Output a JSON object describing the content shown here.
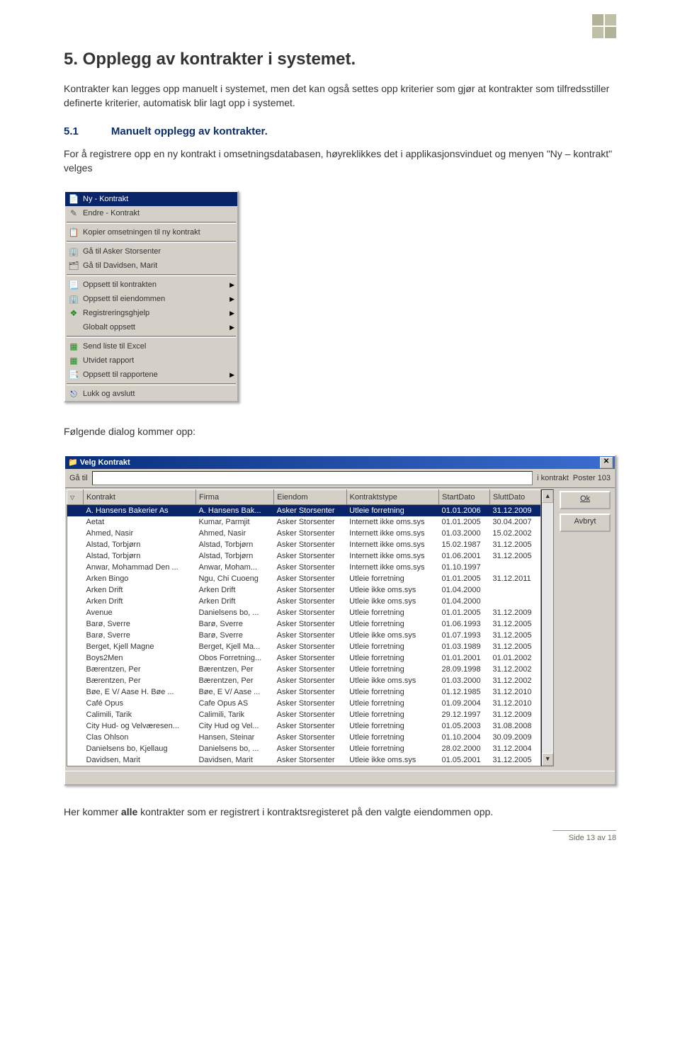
{
  "doc": {
    "section_title": "5. Opplegg av kontrakter i systemet.",
    "p1": "Kontrakter kan legges opp manuelt i systemet, men det kan også settes opp kriterier som gjør at kontrakter som tilfredsstiller definerte kriterier, automatisk blir lagt opp i systemet.",
    "sub_num": "5.1",
    "sub_title": "Manuelt opplegg av kontrakter.",
    "p2": "For å registrere opp en ny kontrakt i omsetningsdatabasen, høyreklikkes det i applikasjonsvinduet og menyen \"Ny – kontrakt\" velges",
    "p3": "Følgende dialog kommer opp:",
    "p4a": "Her kommer ",
    "p4b": "alle",
    "p4c": " kontrakter som er registrert i kontraktsregisteret på den valgte eiendommen opp.",
    "page_number": "Side 13 av 18"
  },
  "menu": {
    "items": [
      {
        "label": "Ny - Kontrakt",
        "selected": true,
        "sep": false,
        "sub": false,
        "icon": "doc"
      },
      {
        "label": "Endre - Kontrakt",
        "sep": false,
        "sub": false,
        "icon": "edit"
      },
      {
        "label": "",
        "sep": true
      },
      {
        "label": "Kopier omsetningen til ny kontrakt",
        "sep": false,
        "sub": false,
        "icon": "copy"
      },
      {
        "label": "",
        "sep": true
      },
      {
        "label": "Gå til Asker Storsenter",
        "sep": false,
        "sub": false,
        "icon": "bld"
      },
      {
        "label": "Gå til Davidsen, Marit",
        "sep": false,
        "sub": false,
        "icon": "card"
      },
      {
        "label": "",
        "sep": true
      },
      {
        "label": "Oppsett til kontrakten",
        "sep": false,
        "sub": true,
        "icon": "page"
      },
      {
        "label": "Oppsett til eiendommen",
        "sep": false,
        "sub": true,
        "icon": "bld"
      },
      {
        "label": "Registreringsghjelp",
        "sep": false,
        "sub": true,
        "icon": "help"
      },
      {
        "label": "Globalt oppsett",
        "sep": false,
        "sub": true,
        "icon": ""
      },
      {
        "label": "",
        "sep": true
      },
      {
        "label": "Send liste til Excel",
        "sep": false,
        "sub": false,
        "icon": "xlsx"
      },
      {
        "label": "Utvidet rapport",
        "sep": false,
        "sub": false,
        "icon": "xlsx"
      },
      {
        "label": "Oppsett til rapportene",
        "sep": false,
        "sub": true,
        "icon": "rep"
      },
      {
        "label": "",
        "sep": true
      },
      {
        "label": "Lukk og avslutt",
        "sep": false,
        "sub": false,
        "icon": "exit"
      }
    ]
  },
  "dialog": {
    "title": "Velg Kontrakt",
    "goto_label": "Gå til",
    "in_contract": "i kontrakt",
    "posts": "Poster 103",
    "ok": "Ok",
    "cancel": "Avbryt",
    "columns": [
      "",
      "Kontrakt",
      "Firma",
      "Eiendom",
      "Kontraktstype",
      "StartDato",
      "SluttDato"
    ],
    "rows": [
      [
        "A. Hansens Bakerier As",
        "A. Hansens Bak...",
        "Asker Storsenter",
        "Utleie forretning",
        "01.01.2006",
        "31.12.2009",
        true
      ],
      [
        "Aetat",
        "Kumar, Parmjit",
        "Asker Storsenter",
        "Internett ikke oms.sys",
        "01.01.2005",
        "30.04.2007",
        false
      ],
      [
        "Ahmed, Nasir",
        "Ahmed, Nasir",
        "Asker Storsenter",
        "Internett ikke oms.sys",
        "01.03.2000",
        "15.02.2002",
        false
      ],
      [
        "Alstad, Torbjørn",
        "Alstad, Torbjørn",
        "Asker Storsenter",
        "Internett ikke oms.sys",
        "15.02.1987",
        "31.12.2005",
        false
      ],
      [
        "Alstad, Torbjørn",
        "Alstad, Torbjørn",
        "Asker Storsenter",
        "Internett ikke oms.sys",
        "01.06.2001",
        "31.12.2005",
        false
      ],
      [
        "Anwar, Mohammad Den ...",
        "Anwar, Moham...",
        "Asker Storsenter",
        "Internett ikke oms.sys",
        "01.10.1997",
        "",
        false
      ],
      [
        "Arken Bingo",
        "Ngu, Chi Cuoeng",
        "Asker Storsenter",
        "Utleie forretning",
        "01.01.2005",
        "31.12.2011",
        false
      ],
      [
        "Arken Drift",
        "Arken Drift",
        "Asker Storsenter",
        "Utleie ikke oms.sys",
        "01.04.2000",
        "",
        false
      ],
      [
        "Arken Drift",
        "Arken Drift",
        "Asker Storsenter",
        "Utleie ikke oms.sys",
        "01.04.2000",
        "",
        false
      ],
      [
        "Avenue",
        "Danielsens bo, ...",
        "Asker Storsenter",
        "Utleie forretning",
        "01.01.2005",
        "31.12.2009",
        false
      ],
      [
        "Barø, Sverre",
        "Barø, Sverre",
        "Asker Storsenter",
        "Utleie forretning",
        "01.06.1993",
        "31.12.2005",
        false
      ],
      [
        "Barø, Sverre",
        "Barø, Sverre",
        "Asker Storsenter",
        "Utleie ikke oms.sys",
        "01.07.1993",
        "31.12.2005",
        false
      ],
      [
        "Berget, Kjell Magne",
        "Berget, Kjell Ma...",
        "Asker Storsenter",
        "Utleie forretning",
        "01.03.1989",
        "31.12.2005",
        false
      ],
      [
        "Boys2Men",
        "Obos Forretning...",
        "Asker Storsenter",
        "Utleie forretning",
        "01.01.2001",
        "01.01.2002",
        false
      ],
      [
        "Bærentzen, Per",
        "Bærentzen, Per",
        "Asker Storsenter",
        "Utleie forretning",
        "28.09.1998",
        "31.12.2002",
        false
      ],
      [
        "Bærentzen, Per",
        "Bærentzen, Per",
        "Asker Storsenter",
        "Utleie ikke oms.sys",
        "01.03.2000",
        "31.12.2002",
        false
      ],
      [
        "Bøe, E V/ Aase H. Bøe ...",
        "Bøe, E V/ Aase ...",
        "Asker Storsenter",
        "Utleie forretning",
        "01.12.1985",
        "31.12.2010",
        false
      ],
      [
        "Café Opus",
        "Cafe Opus AS",
        "Asker Storsenter",
        "Utleie forretning",
        "01.09.2004",
        "31.12.2010",
        false
      ],
      [
        "Calimili, Tarik",
        "Calimili, Tarik",
        "Asker Storsenter",
        "Utleie forretning",
        "29.12.1997",
        "31.12.2009",
        false
      ],
      [
        "City Hud- og Velværesen...",
        "City Hud og Vel...",
        "Asker Storsenter",
        "Utleie forretning",
        "01.05.2003",
        "31.08.2008",
        false
      ],
      [
        "Clas Ohlson",
        "Hansen, Steinar",
        "Asker Storsenter",
        "Utleie forretning",
        "01.10.2004",
        "30.09.2009",
        false
      ],
      [
        "Danielsens bo, Kjellaug",
        "Danielsens bo, ...",
        "Asker Storsenter",
        "Utleie forretning",
        "28.02.2000",
        "31.12.2004",
        false
      ],
      [
        "Davidsen, Marit",
        "Davidsen, Marit",
        "Asker Storsenter",
        "Utleie ikke oms.sys",
        "01.05.2001",
        "31.12.2005",
        false
      ]
    ]
  }
}
